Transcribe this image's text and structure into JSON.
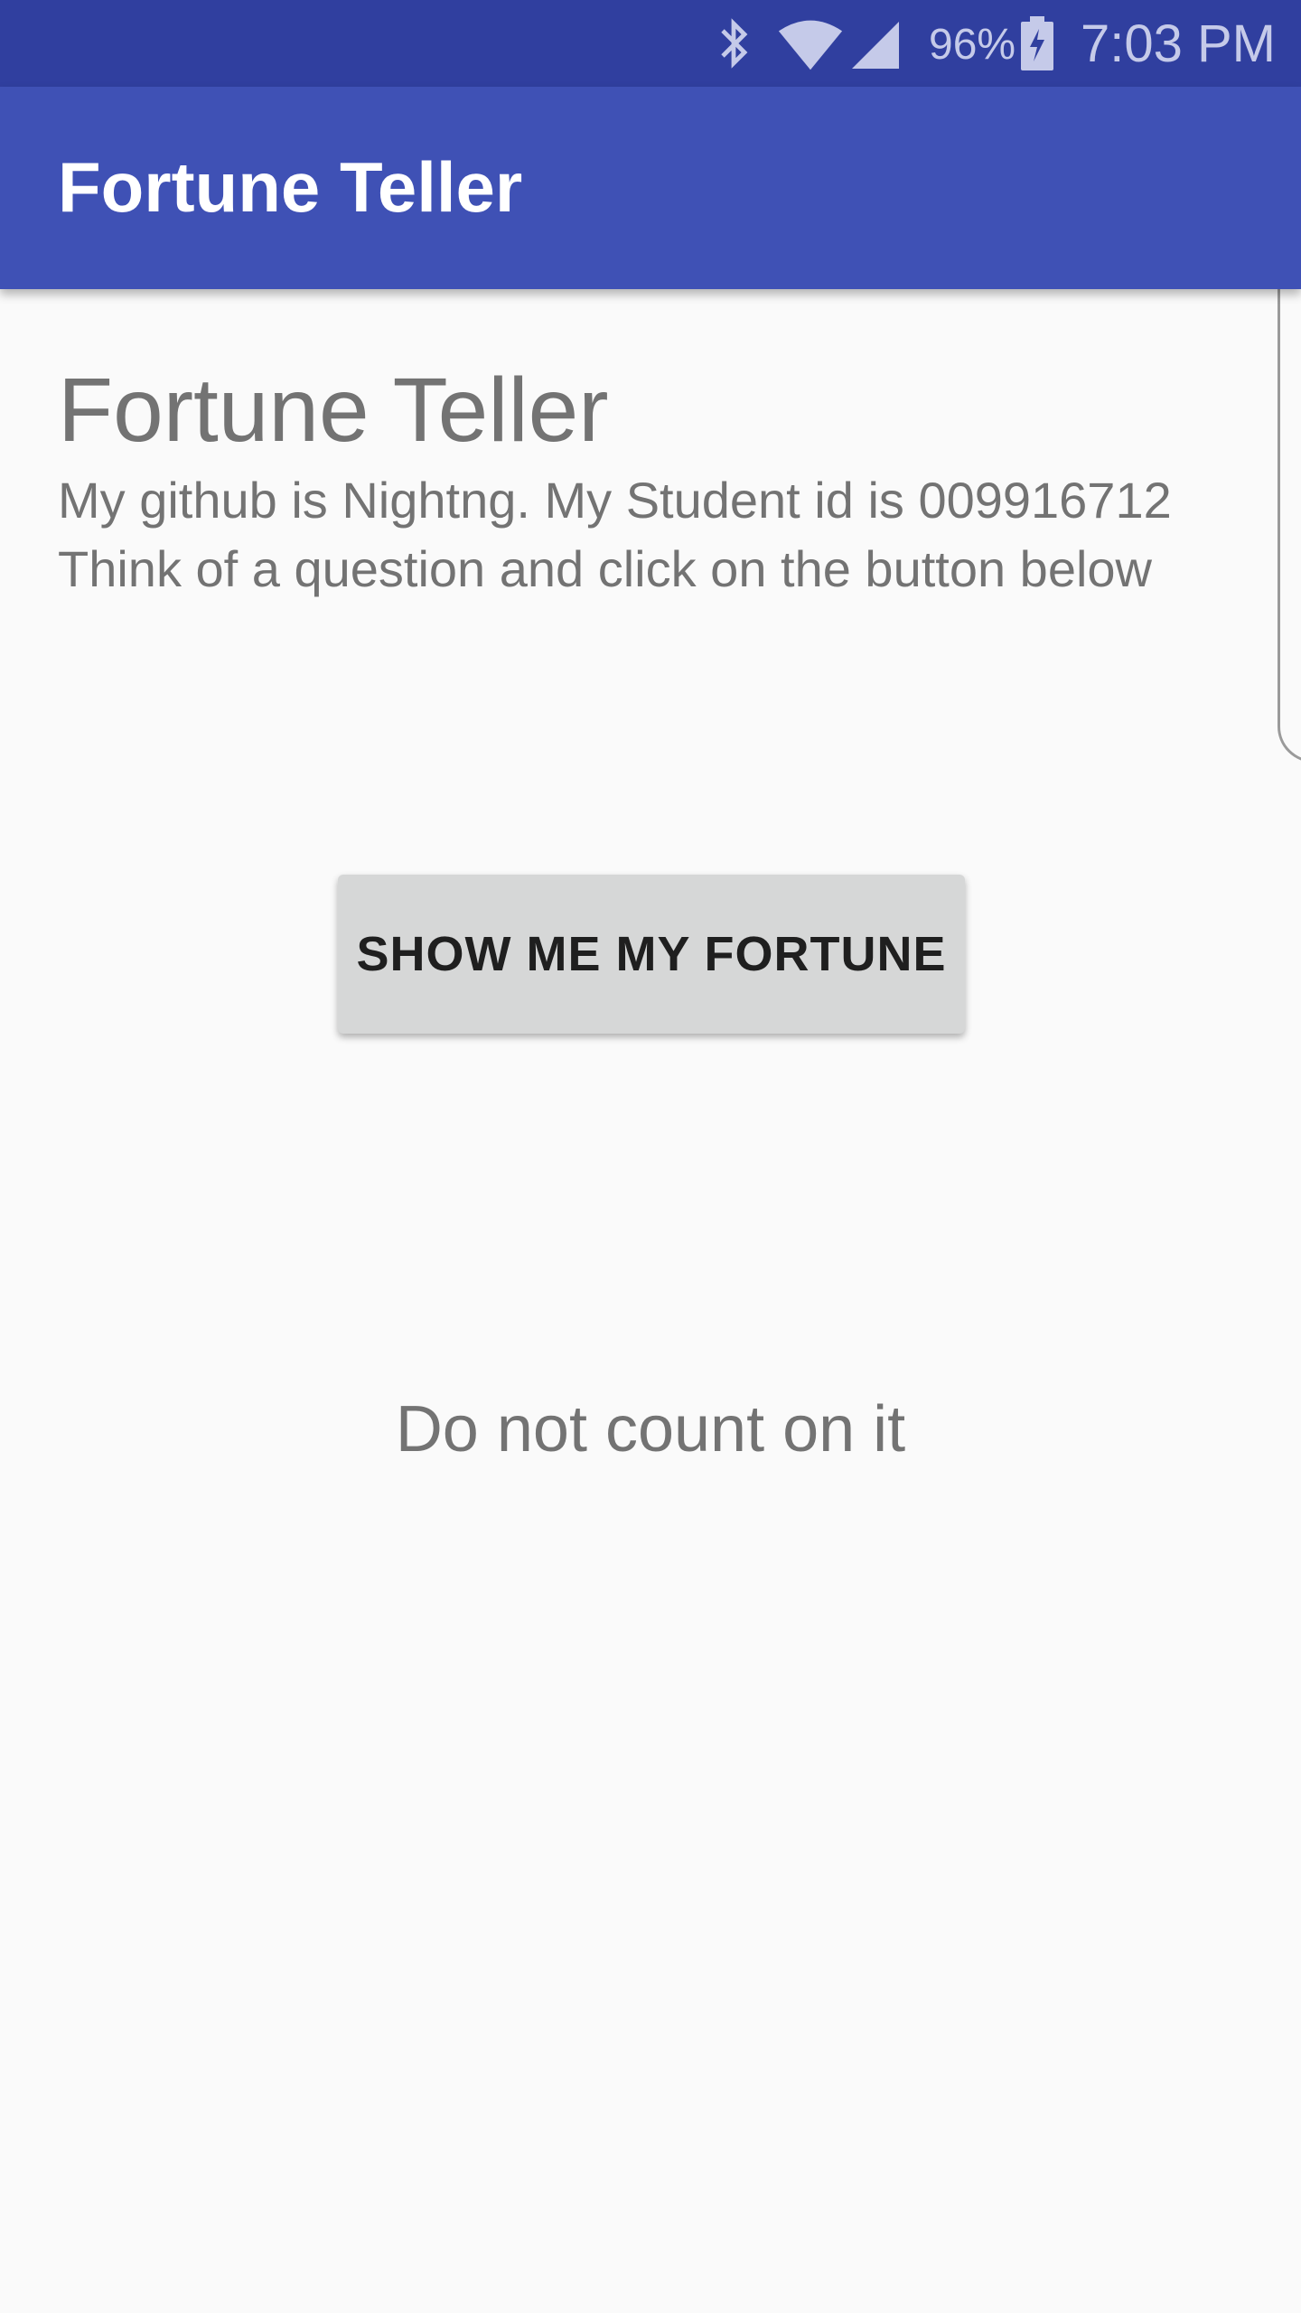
{
  "status_bar": {
    "bluetooth_icon": "bluetooth-icon",
    "wifi_icon": "wifi-icon",
    "signal_icon": "cell-signal-icon",
    "battery_percent": "96%",
    "battery_icon": "battery-charging-icon",
    "time": "7:03 PM",
    "background_color": "#303f9f"
  },
  "app_bar": {
    "title": "Fortune Teller",
    "background_color": "#3f51b5"
  },
  "content": {
    "heading": "Fortune Teller",
    "line1": "My github is Nightng. My Student id is 009916712",
    "line2": "Think of a question and click on the button below",
    "button_label": "SHOW ME MY FORTUNE",
    "fortune_text": "Do not count on it"
  }
}
